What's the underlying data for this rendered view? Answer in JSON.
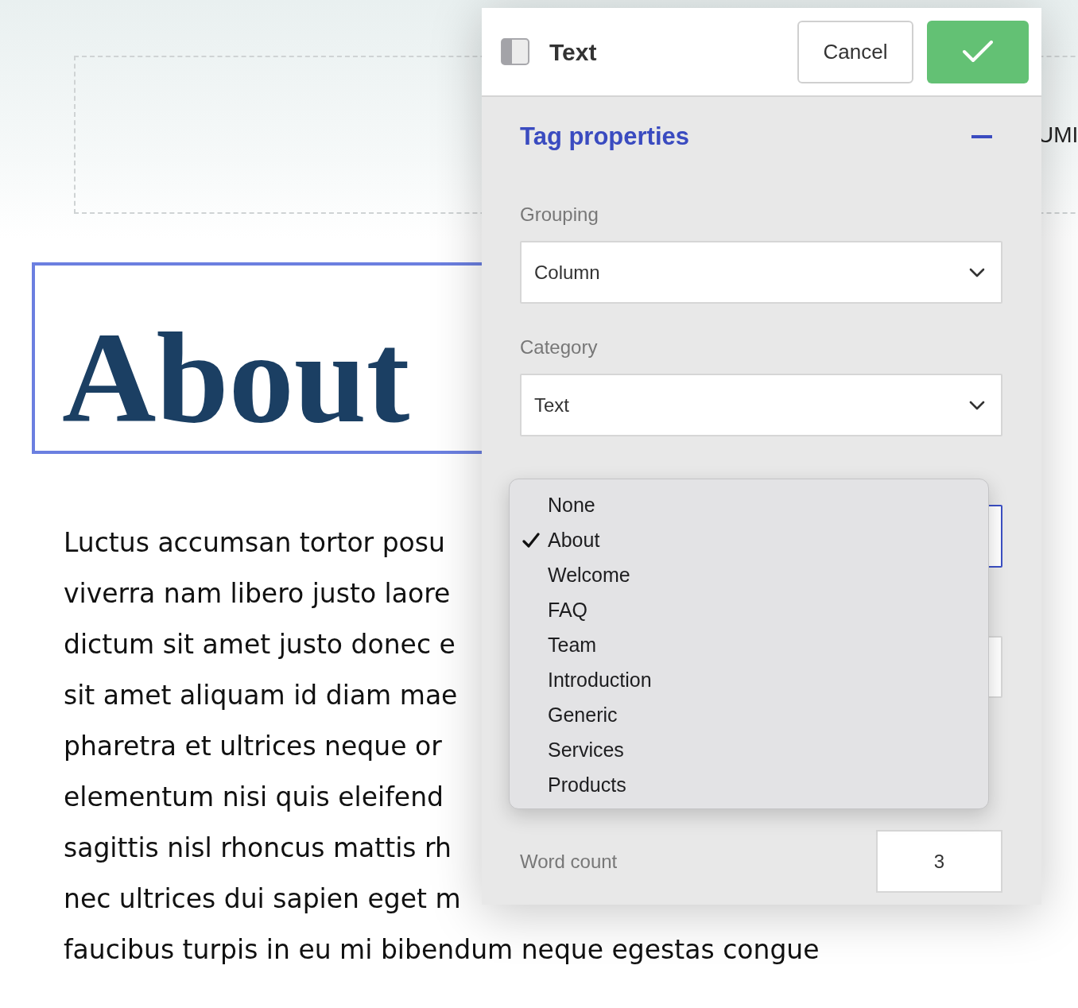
{
  "page": {
    "heading": "About",
    "side_text": "UMI",
    "paragraph_lines": [
      "Luctus accumsan tortor posu",
      "viverra nam libero justo laore",
      "dictum sit amet justo donec e",
      "sit amet aliquam id diam mae",
      "pharetra et ultrices neque or",
      "elementum nisi quis eleifend",
      "sagittis nisl rhoncus mattis rh",
      "nec ultrices dui sapien eget m",
      "faucibus turpis in eu mi bibendum neque egestas congue"
    ]
  },
  "panel": {
    "title": "Text",
    "cancel": "Cancel",
    "section": {
      "title": "Tag properties",
      "expanded": true
    },
    "fields": [
      {
        "label": "Grouping",
        "value": "Column",
        "focused": false
      },
      {
        "label": "Category",
        "value": "Text",
        "focused": false
      },
      {
        "focused": true
      }
    ],
    "word_count": {
      "label": "Word count",
      "value": "3"
    }
  },
  "dropdown": {
    "options": [
      {
        "label": "None",
        "selected": false
      },
      {
        "label": "About",
        "selected": true
      },
      {
        "label": "Welcome",
        "selected": false
      },
      {
        "label": "FAQ",
        "selected": false
      },
      {
        "label": "Team",
        "selected": false
      },
      {
        "label": "Introduction",
        "selected": false
      },
      {
        "label": "Generic",
        "selected": false
      },
      {
        "label": "Services",
        "selected": false
      },
      {
        "label": "Products",
        "selected": false
      }
    ]
  }
}
